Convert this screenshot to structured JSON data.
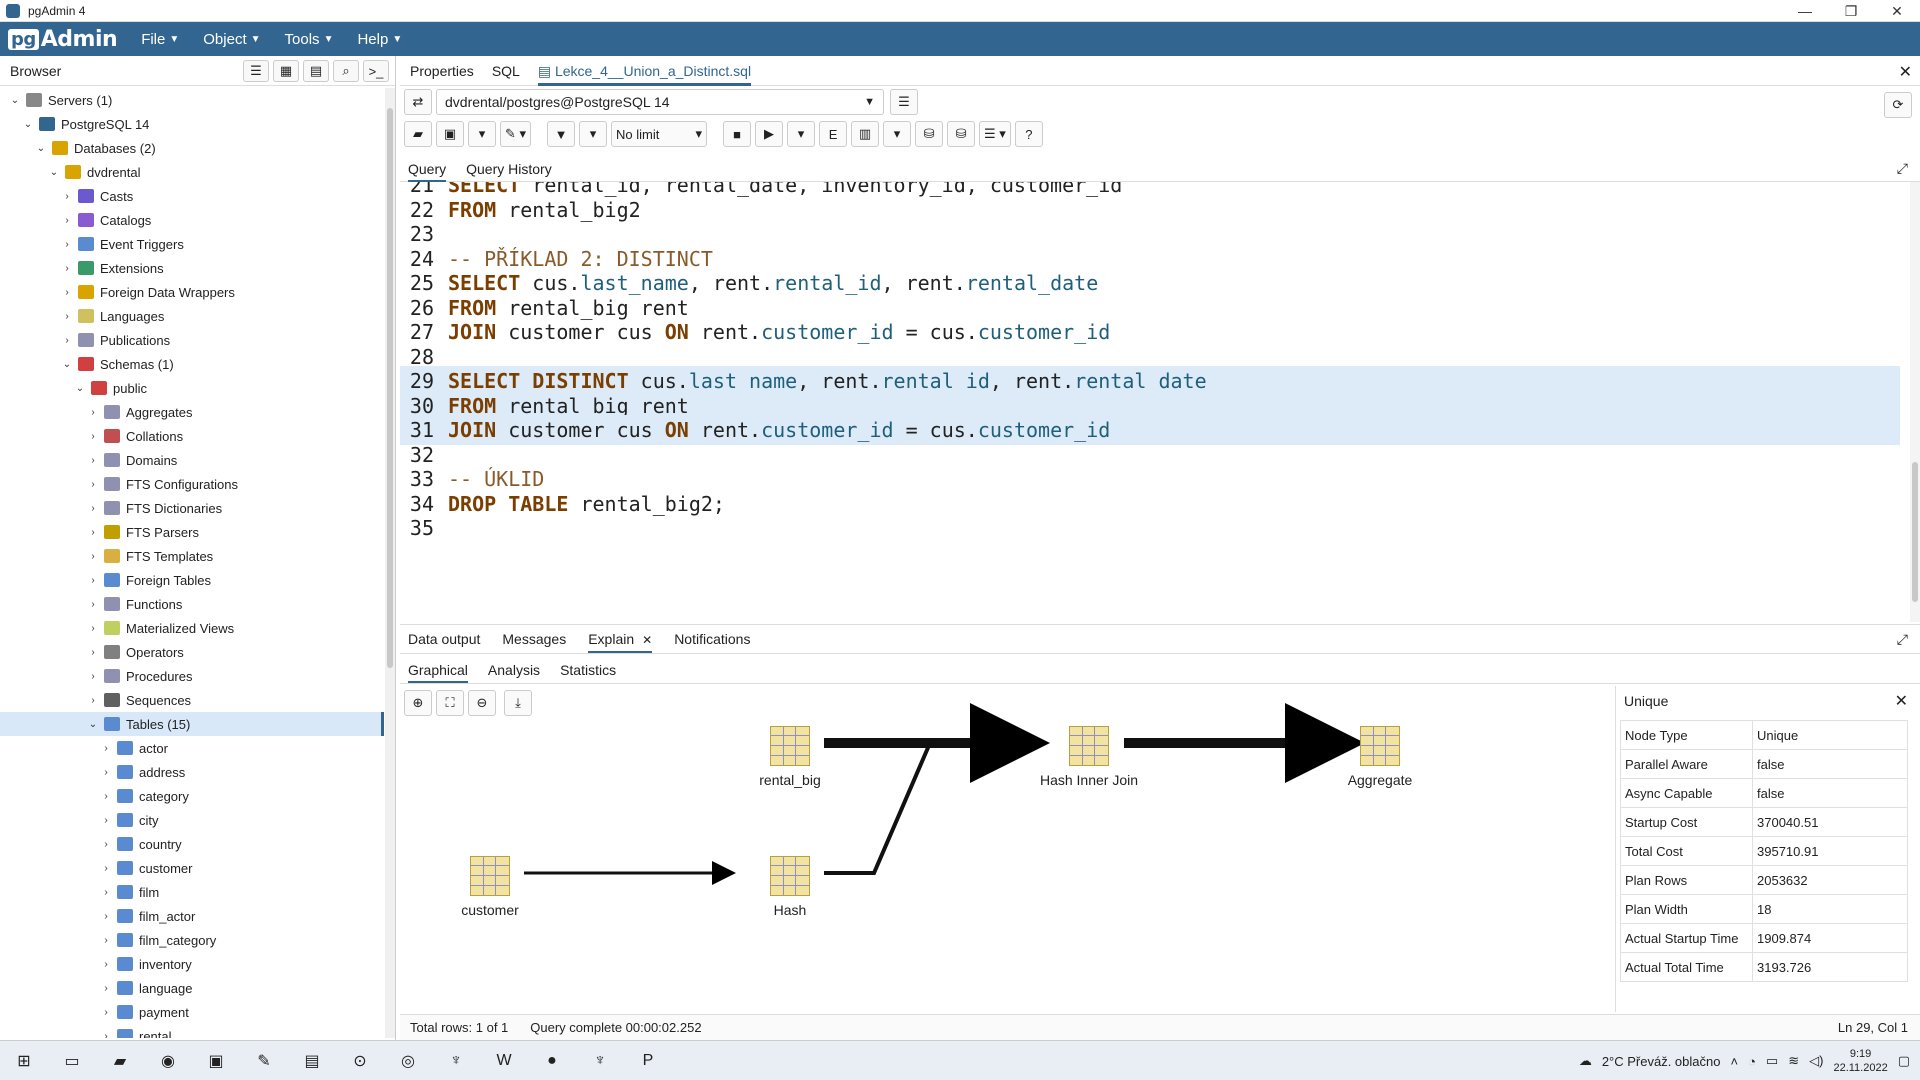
{
  "window": {
    "title": "pgAdmin 4",
    "minimize": "—",
    "maximize": "❐",
    "close": "✕"
  },
  "menubar": {
    "logo_pg": "pg",
    "logo_admin": "Admin",
    "items": [
      "File",
      "Object",
      "Tools",
      "Help"
    ]
  },
  "browser": {
    "title": "Browser",
    "tree": [
      {
        "label": "Servers (1)",
        "indent": 0,
        "chev": "v",
        "color": "#888888"
      },
      {
        "label": "PostgreSQL 14",
        "indent": 1,
        "chev": "v",
        "color": "#326690"
      },
      {
        "label": "Databases (2)",
        "indent": 2,
        "chev": "v",
        "color": "#d9a300"
      },
      {
        "label": "dvdrental",
        "indent": 3,
        "chev": "v",
        "color": "#d9a300"
      },
      {
        "label": "Casts",
        "indent": 4,
        "chev": ">",
        "color": "#6a5acd"
      },
      {
        "label": "Catalogs",
        "indent": 4,
        "chev": ">",
        "color": "#8a5ad0"
      },
      {
        "label": "Event Triggers",
        "indent": 4,
        "chev": ">",
        "color": "#5a8ad0"
      },
      {
        "label": "Extensions",
        "indent": 4,
        "chev": ">",
        "color": "#3a9a6a"
      },
      {
        "label": "Foreign Data Wrappers",
        "indent": 4,
        "chev": ">",
        "color": "#d9a300"
      },
      {
        "label": "Languages",
        "indent": 4,
        "chev": ">",
        "color": "#d0c060"
      },
      {
        "label": "Publications",
        "indent": 4,
        "chev": ">",
        "color": "#9090b0"
      },
      {
        "label": "Schemas (1)",
        "indent": 4,
        "chev": "v",
        "color": "#d04040"
      },
      {
        "label": "public",
        "indent": 5,
        "chev": "v",
        "color": "#d04040"
      },
      {
        "label": "Aggregates",
        "indent": 6,
        "chev": ">",
        "color": "#9090b0"
      },
      {
        "label": "Collations",
        "indent": 6,
        "chev": ">",
        "color": "#c05050"
      },
      {
        "label": "Domains",
        "indent": 6,
        "chev": ">",
        "color": "#9090b0"
      },
      {
        "label": "FTS Configurations",
        "indent": 6,
        "chev": ">",
        "color": "#9090b0"
      },
      {
        "label": "FTS Dictionaries",
        "indent": 6,
        "chev": ">",
        "color": "#9090b0"
      },
      {
        "label": "FTS Parsers",
        "indent": 6,
        "chev": ">",
        "color": "#c0a000"
      },
      {
        "label": "FTS Templates",
        "indent": 6,
        "chev": ">",
        "color": "#d9b040"
      },
      {
        "label": "Foreign Tables",
        "indent": 6,
        "chev": ">",
        "color": "#5a8ad0"
      },
      {
        "label": "Functions",
        "indent": 6,
        "chev": ">",
        "color": "#9090b0"
      },
      {
        "label": "Materialized Views",
        "indent": 6,
        "chev": ">",
        "color": "#c0d060"
      },
      {
        "label": "Operators",
        "indent": 6,
        "chev": ">",
        "color": "#808080"
      },
      {
        "label": "Procedures",
        "indent": 6,
        "chev": ">",
        "color": "#9090b0"
      },
      {
        "label": "Sequences",
        "indent": 6,
        "chev": ">",
        "color": "#606060"
      },
      {
        "label": "Tables (15)",
        "indent": 6,
        "chev": "v",
        "color": "#5a8ad0",
        "selected": true
      },
      {
        "label": "actor",
        "indent": 7,
        "chev": ">",
        "color": "#5a8ad0"
      },
      {
        "label": "address",
        "indent": 7,
        "chev": ">",
        "color": "#5a8ad0"
      },
      {
        "label": "category",
        "indent": 7,
        "chev": ">",
        "color": "#5a8ad0"
      },
      {
        "label": "city",
        "indent": 7,
        "chev": ">",
        "color": "#5a8ad0"
      },
      {
        "label": "country",
        "indent": 7,
        "chev": ">",
        "color": "#5a8ad0"
      },
      {
        "label": "customer",
        "indent": 7,
        "chev": ">",
        "color": "#5a8ad0"
      },
      {
        "label": "film",
        "indent": 7,
        "chev": ">",
        "color": "#5a8ad0"
      },
      {
        "label": "film_actor",
        "indent": 7,
        "chev": ">",
        "color": "#5a8ad0"
      },
      {
        "label": "film_category",
        "indent": 7,
        "chev": ">",
        "color": "#5a8ad0"
      },
      {
        "label": "inventory",
        "indent": 7,
        "chev": ">",
        "color": "#5a8ad0"
      },
      {
        "label": "language",
        "indent": 7,
        "chev": ">",
        "color": "#5a8ad0"
      },
      {
        "label": "payment",
        "indent": 7,
        "chev": ">",
        "color": "#5a8ad0"
      },
      {
        "label": "rental",
        "indent": 7,
        "chev": ">",
        "color": "#5a8ad0"
      }
    ]
  },
  "main": {
    "tabs": [
      "Properties",
      "SQL",
      "Lekce_4__Union_a_Distinct.sql"
    ],
    "connection": "dvdrental/postgres@PostgreSQL 14",
    "limit": "No limit",
    "query_tabs": [
      "Query",
      "Query History"
    ],
    "code_lines": [
      {
        "n": "21",
        "text": "SELECT rental_id, rental_date, inventory_id, customer_id",
        "hl": false
      },
      {
        "n": "22",
        "text": "FROM rental_big2",
        "hl": false
      },
      {
        "n": "23",
        "text": "",
        "hl": false
      },
      {
        "n": "24",
        "text": "-- PŘÍKLAD 2: DISTINCT",
        "hl": false
      },
      {
        "n": "25",
        "text": "SELECT cus.last_name, rent.rental_id, rent.rental_date",
        "hl": false
      },
      {
        "n": "26",
        "text": "FROM rental_big rent",
        "hl": false
      },
      {
        "n": "27",
        "text": "JOIN customer cus ON rent.customer_id = cus.customer_id",
        "hl": false
      },
      {
        "n": "28",
        "text": "",
        "hl": false
      },
      {
        "n": "29",
        "text": "SELECT DISTINCT cus.last_name, rent.rental_id, rent.rental_date",
        "hl": true
      },
      {
        "n": "30",
        "text": "FROM rental_big rent",
        "hl": true
      },
      {
        "n": "31",
        "text": "JOIN customer cus ON rent.customer_id = cus.customer_id",
        "hl": true
      },
      {
        "n": "32",
        "text": "",
        "hl": false
      },
      {
        "n": "33",
        "text": "-- ÚKLID",
        "hl": false
      },
      {
        "n": "34",
        "text": "DROP TABLE rental_big2;",
        "hl": false
      },
      {
        "n": "35",
        "text": "",
        "hl": false
      }
    ],
    "output_tabs": [
      "Data output",
      "Messages",
      "Explain",
      "Notifications"
    ],
    "explain_tabs": [
      "Graphical",
      "Analysis",
      "Statistics"
    ],
    "plan_nodes": {
      "rental_big": "rental_big",
      "hash_inner_join": "Hash Inner Join",
      "aggregate": "Aggregate",
      "customer": "customer",
      "hash": "Hash"
    },
    "details": {
      "title": "Unique",
      "rows": [
        {
          "k": "Node Type",
          "v": "Unique"
        },
        {
          "k": "Parallel Aware",
          "v": "false"
        },
        {
          "k": "Async Capable",
          "v": "false"
        },
        {
          "k": "Startup Cost",
          "v": "370040.51"
        },
        {
          "k": "Total Cost",
          "v": "395710.91"
        },
        {
          "k": "Plan Rows",
          "v": "2053632"
        },
        {
          "k": "Plan Width",
          "v": "18"
        },
        {
          "k": "Actual Startup Time",
          "v": "1909.874"
        },
        {
          "k": "Actual Total Time",
          "v": "3193.726"
        }
      ]
    },
    "status": {
      "rows": "Total rows: 1 of 1",
      "query": "Query complete 00:00:02.252",
      "position": "Ln 29, Col 1"
    }
  },
  "taskbar": {
    "weather": "2°C  Převáž. oblačno",
    "time": "9:19",
    "date": "22.11.2022"
  }
}
